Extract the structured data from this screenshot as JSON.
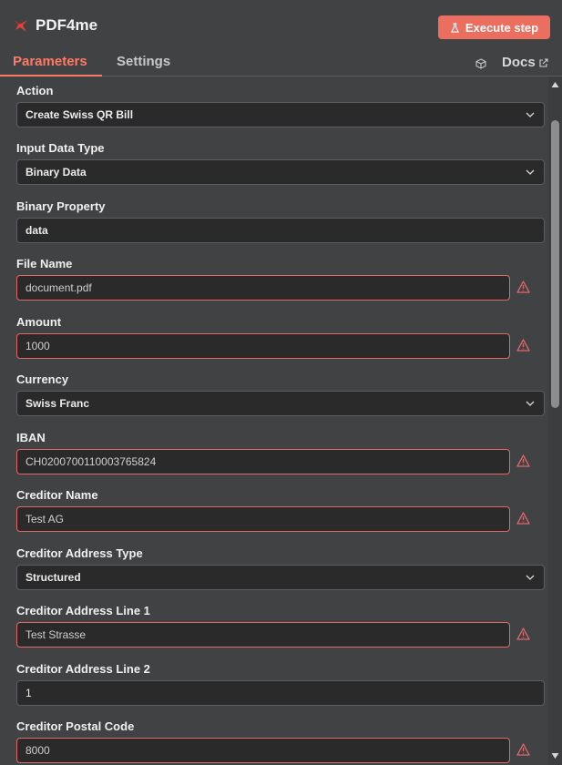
{
  "header": {
    "title": "PDF4me",
    "execute_label": "Execute step",
    "logo_icon": "pdf4me-logo-icon",
    "accent": "#ec6e5f"
  },
  "tabs": {
    "parameters": "Parameters",
    "settings": "Settings",
    "docs": "Docs"
  },
  "fields": {
    "action": {
      "label": "Action",
      "value": "Create Swiss QR Bill"
    },
    "input_data_type": {
      "label": "Input Data Type",
      "value": "Binary Data"
    },
    "binary_property": {
      "label": "Binary Property",
      "value": "data"
    },
    "file_name": {
      "label": "File Name",
      "value": "document.pdf"
    },
    "amount": {
      "label": "Amount",
      "value": "1000"
    },
    "currency": {
      "label": "Currency",
      "value": "Swiss Franc"
    },
    "iban": {
      "label": "IBAN",
      "value": "CH0200700110003765824"
    },
    "creditor_name": {
      "label": "Creditor Name",
      "value": "Test AG"
    },
    "creditor_address_type": {
      "label": "Creditor Address Type",
      "value": "Structured"
    },
    "creditor_address_line1": {
      "label": "Creditor Address Line 1",
      "value": "Test Strasse"
    },
    "creditor_address_line2": {
      "label": "Creditor Address Line 2",
      "value": "1"
    },
    "creditor_postal_code": {
      "label": "Creditor Postal Code",
      "value": "8000"
    }
  },
  "colors": {
    "error_border": "#e06a6a",
    "active_tab": "#ff7a66"
  }
}
